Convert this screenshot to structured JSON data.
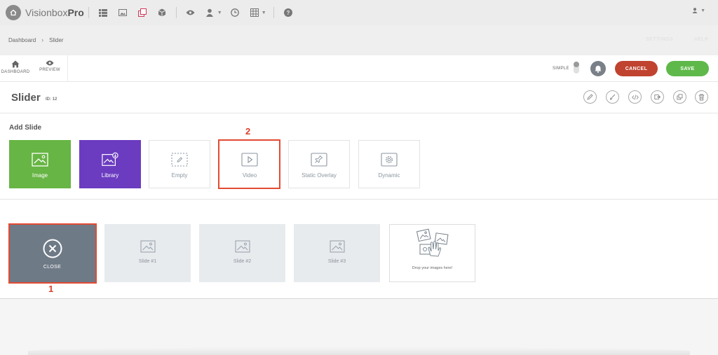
{
  "topbar": {
    "brand_light": "Visionbox",
    "brand_bold": "Pro"
  },
  "breadcrumb": {
    "items": [
      "Dashboard",
      "Slider"
    ],
    "right_links": [
      "SETTINGS",
      "HELP"
    ]
  },
  "toolbar": {
    "dashboard_label": "DASHBOARD",
    "preview_label": "PREVIEW",
    "simple_label": "SIMPLE",
    "cancel_label": "CANCEL",
    "save_label": "SAVE"
  },
  "page": {
    "title": "Slider",
    "id_label": "ID: 12"
  },
  "add_slide": {
    "title": "Add Slide",
    "tiles": [
      "Image",
      "Library",
      "Empty",
      "Video",
      "Static Overlay",
      "Dynamic"
    ]
  },
  "slides": {
    "close_label": "CLOSE",
    "items": [
      "Slide #1",
      "Slide #2",
      "Slide #3"
    ],
    "drop_text": "Drop your images here!"
  },
  "annotations": {
    "marker_1": "1",
    "marker_2": "2",
    "highlight_color": "#e34a33"
  },
  "colors": {
    "green": "#67b544",
    "purple": "#6b3cc0",
    "cancel": "#c0432f",
    "save": "#5fb94a"
  }
}
